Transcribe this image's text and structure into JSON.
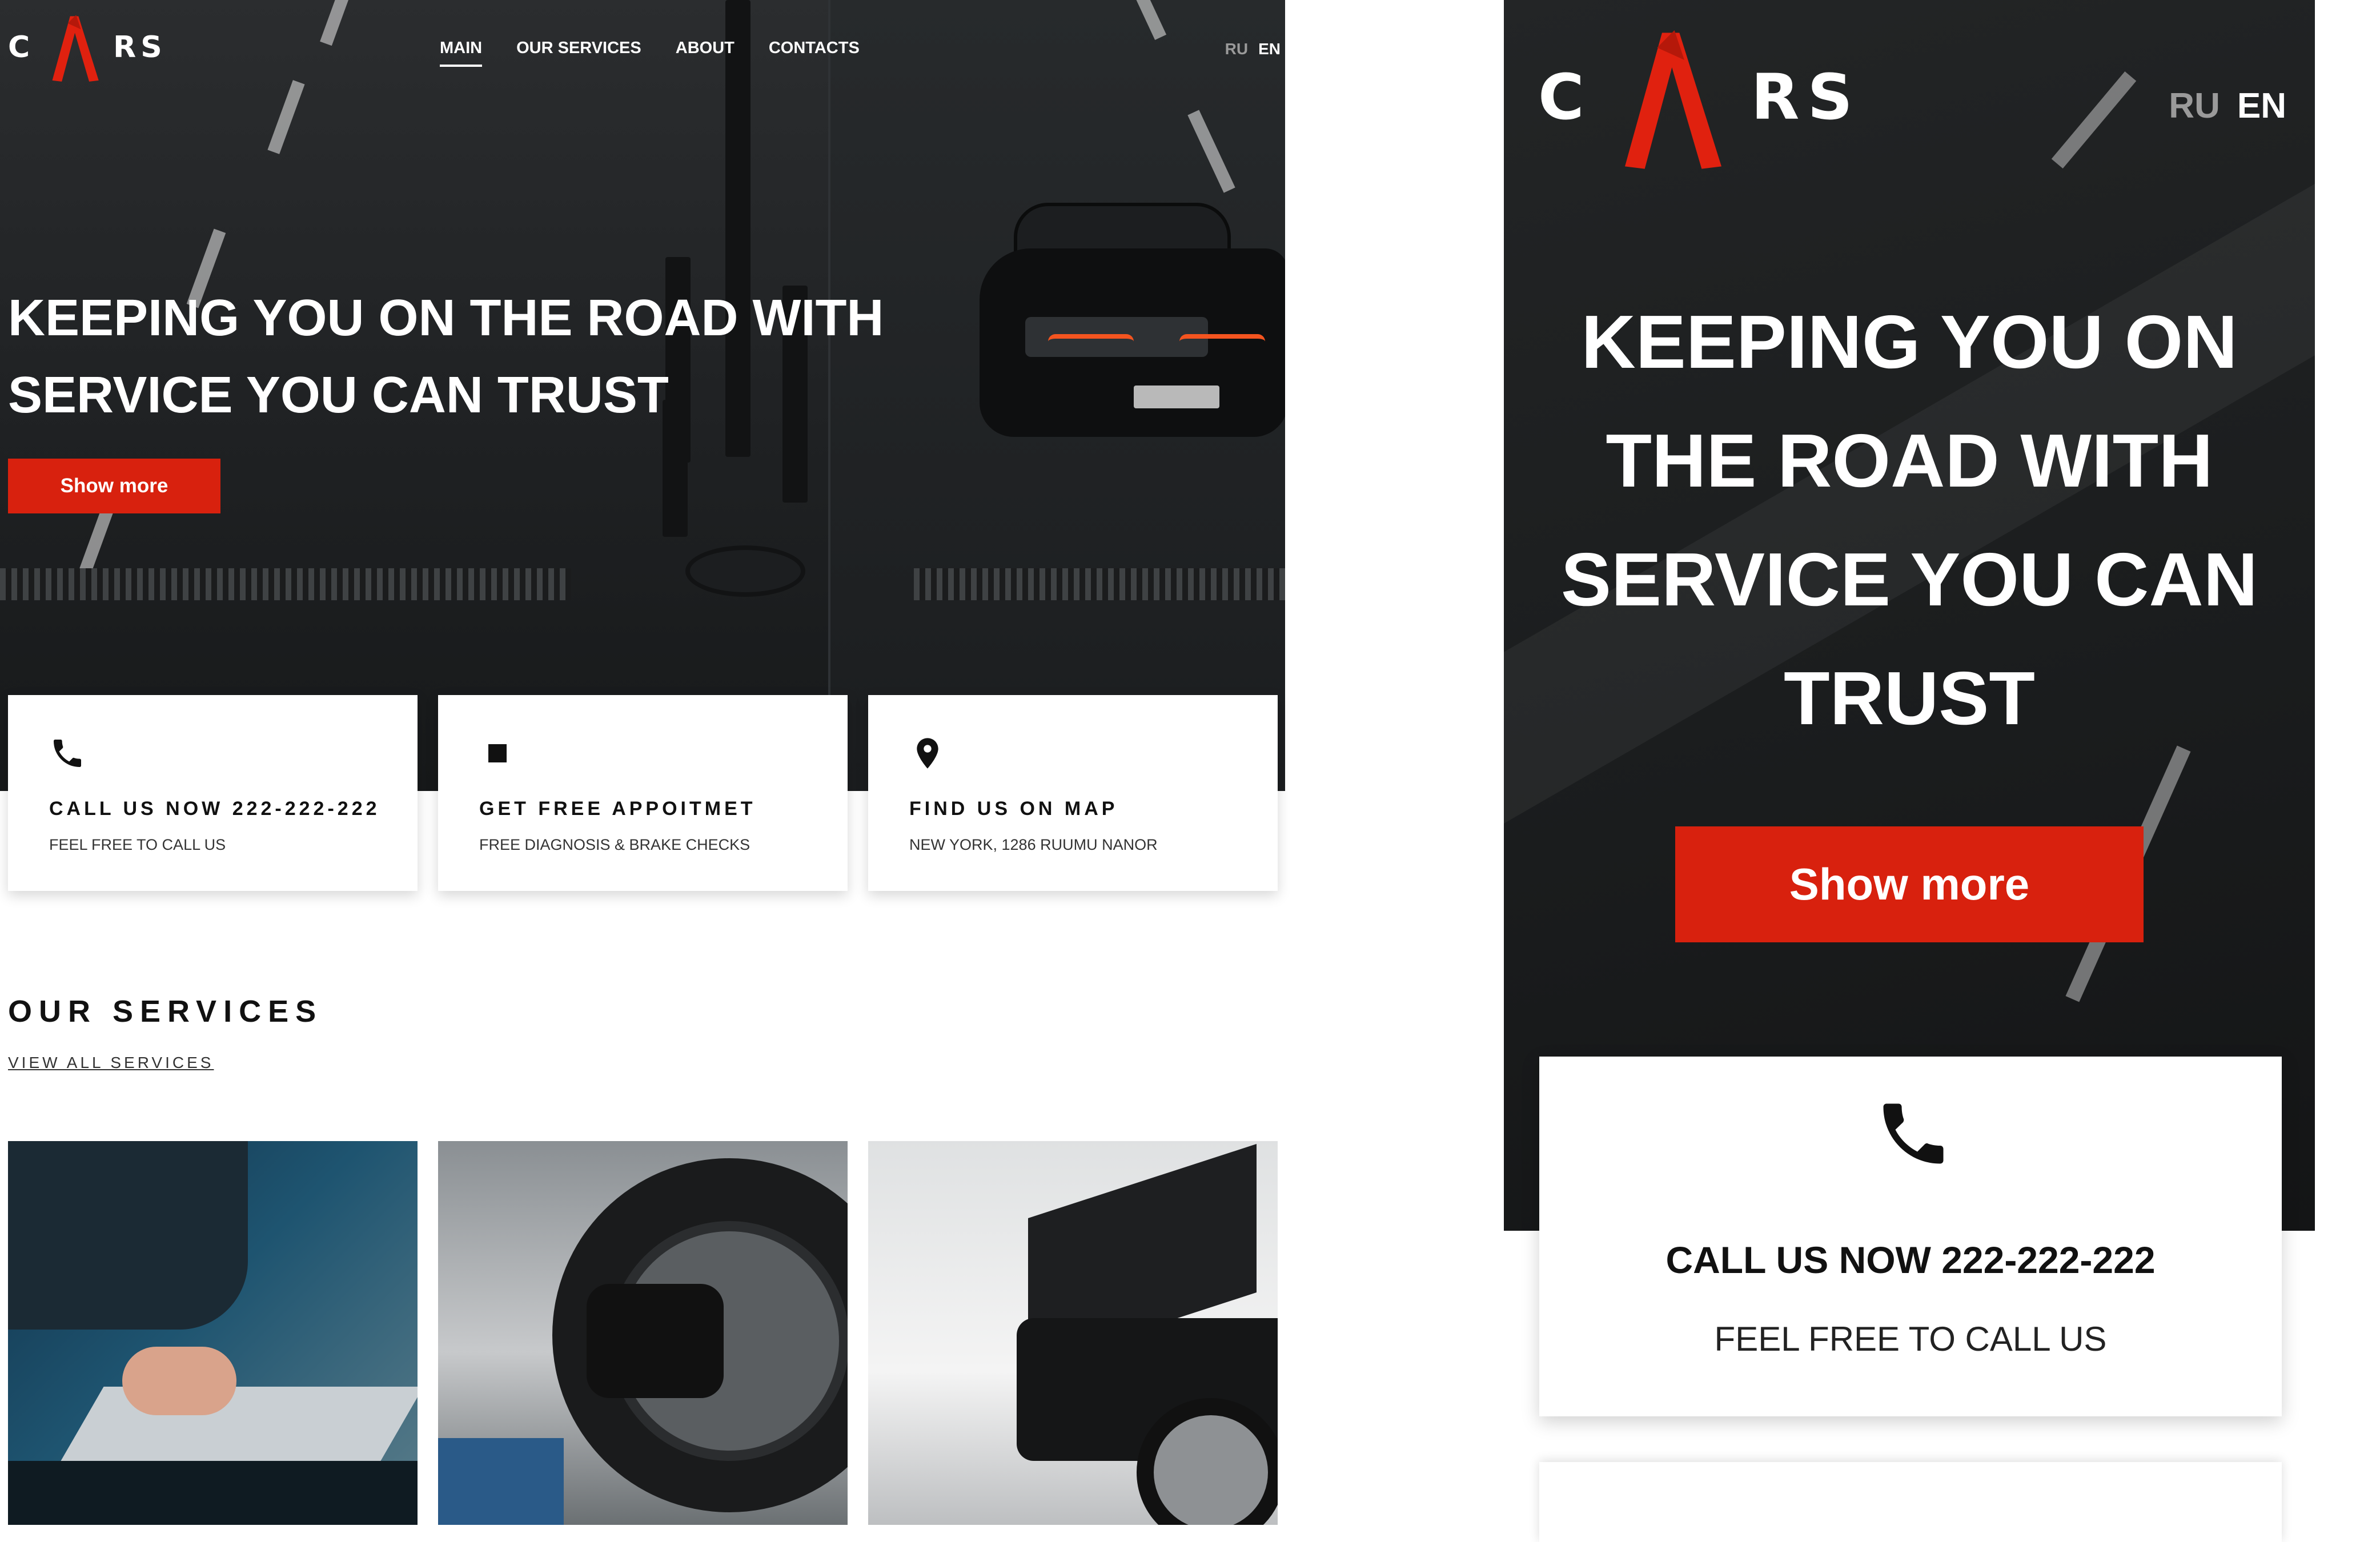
{
  "brand": {
    "letter_c": "C",
    "letter_r": "R",
    "letter_s": "S"
  },
  "nav": {
    "items": [
      {
        "label": "MAIN",
        "active": true
      },
      {
        "label": "OUR SERVICES",
        "active": false
      },
      {
        "label": "ABOUT",
        "active": false
      },
      {
        "label": "CONTACTS",
        "active": false
      }
    ],
    "lang": {
      "ru": "RU",
      "en": "EN",
      "selected": "EN"
    }
  },
  "hero": {
    "headline_line1": "KEEPING YOU ON THE ROAD WITH",
    "headline_line2": "SERVICE YOU CAN TRUST",
    "button": "Show more"
  },
  "mobile": {
    "headline_lines": [
      "KEEPING YOU ON",
      "THE ROAD WITH",
      "SERVICE YOU CAN",
      "TRUST"
    ],
    "button": "Show more",
    "card": {
      "title": "CALL US NOW 222-222-222",
      "subtitle": "FEEL FREE TO CALL US",
      "icon": "phone-icon"
    }
  },
  "features": [
    {
      "icon": "phone-icon",
      "title": "CALL US NOW 222-222-222",
      "subtitle": "FEEL FREE TO CALL US"
    },
    {
      "icon": "square-icon",
      "title": "GET FREE APPOITMET",
      "subtitle": "FREE DIAGNOSIS & BRAKE CHECKS"
    },
    {
      "icon": "map-pin-icon",
      "title": "FIND US ON MAP",
      "subtitle": "NEW YORK, 1286 RUUMU NANOR"
    }
  ],
  "services": {
    "title": "OUR SERVICES",
    "link": "VIEW ALL SERVICES",
    "photos": [
      "laptop-diagnostics-photo",
      "tire-service-photo",
      "car-lift-photo"
    ]
  },
  "colors": {
    "accent": "#d8210e",
    "hero_dark": "#1f2123",
    "white": "#ffffff"
  }
}
